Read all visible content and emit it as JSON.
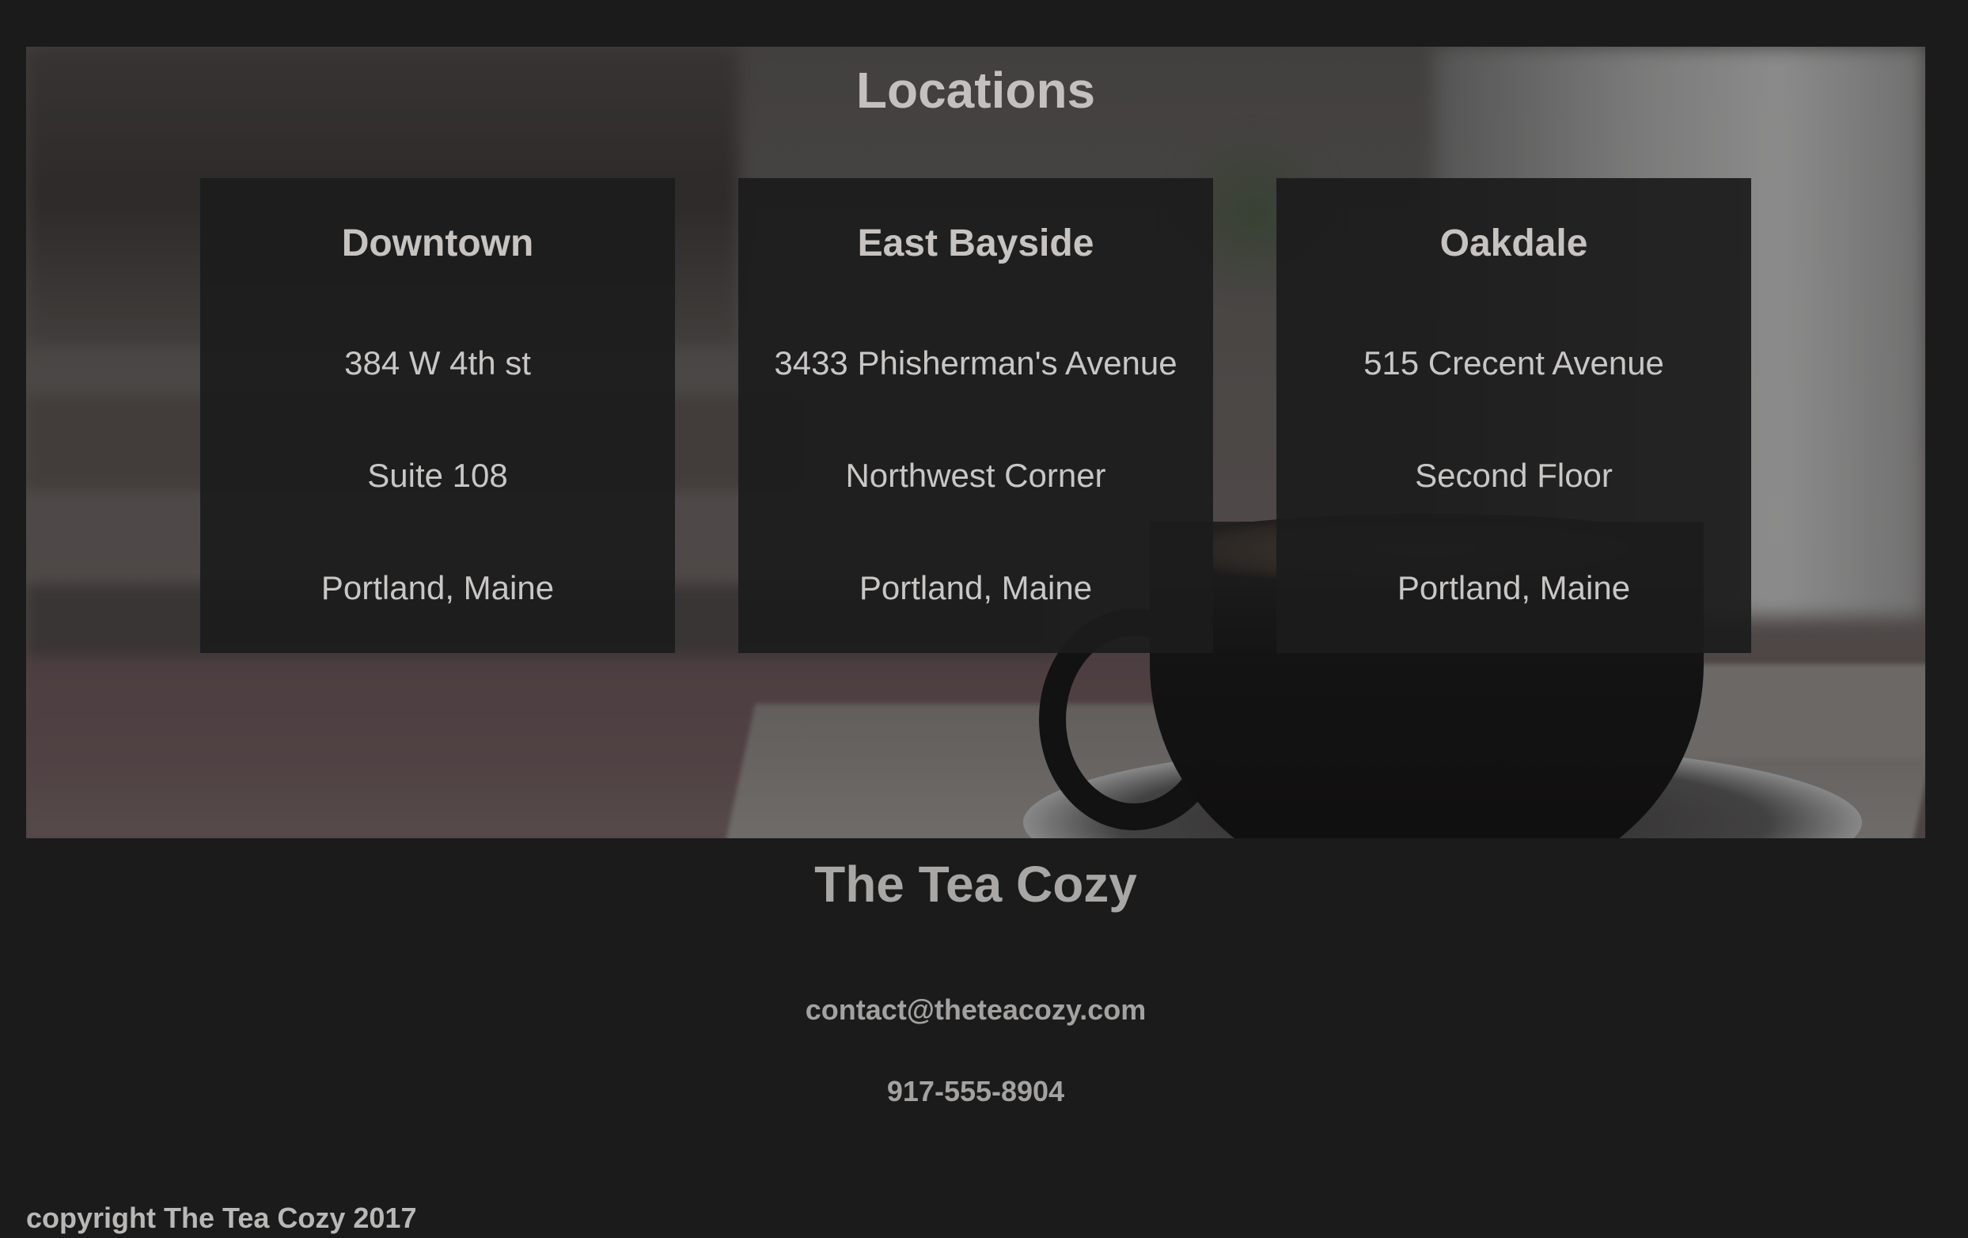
{
  "locations": {
    "heading": "Locations",
    "cards": [
      {
        "name": "Downtown",
        "line1": "384 W 4th st",
        "line2": "Suite 108",
        "line3": "Portland, Maine"
      },
      {
        "name": "East Bayside",
        "line1": "3433 Phisherman's Avenue",
        "line2": "Northwest Corner",
        "line3": "Portland, Maine"
      },
      {
        "name": "Oakdale",
        "line1": "515 Crecent Avenue",
        "line2": "Second Floor",
        "line3": "Portland, Maine"
      }
    ]
  },
  "footer": {
    "title": "The Tea Cozy",
    "email": "contact@theteacozy.com",
    "phone": "917-555-8904",
    "copyright": "copyright The Tea Cozy 2017"
  },
  "colors": {
    "page_background": "#1b1b1b",
    "card_background": "#1c1c1d",
    "text_light": "#c9c9c9",
    "text_muted": "#a3a2a1"
  }
}
